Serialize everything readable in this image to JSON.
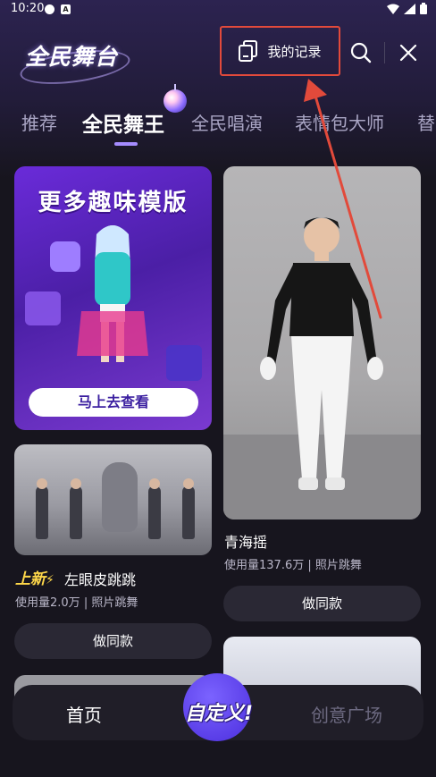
{
  "status_bar": {
    "time": "10:20",
    "notif_badge": "A"
  },
  "header": {
    "logo_text": "全民舞台",
    "record_label": "我的记录"
  },
  "tabs": [
    {
      "label": "推荐"
    },
    {
      "label": "全民舞王"
    },
    {
      "label": "全民唱演"
    },
    {
      "label": "表情包大师"
    },
    {
      "label": "替"
    }
  ],
  "active_tab_index": 1,
  "feed": {
    "promo": {
      "title": "更多趣味模版",
      "button": "马上去查看"
    },
    "left_item": {
      "new_badge": "上新",
      "title": "左眼皮跳跳",
      "usage": "使用量2.0万",
      "category": "照片跳舞",
      "separator": "|",
      "button": "做同款"
    },
    "right_item": {
      "title": "青海摇",
      "usage": "使用量137.6万",
      "category": "照片跳舞",
      "separator": "|",
      "button": "做同款"
    }
  },
  "bottom_nav": {
    "home": "首页",
    "center": "自定义!",
    "plaza": "创意广场"
  },
  "colors": {
    "annotation": "#e24a3b",
    "accent": "#a58cff",
    "new_badge": "#ffd84a"
  }
}
